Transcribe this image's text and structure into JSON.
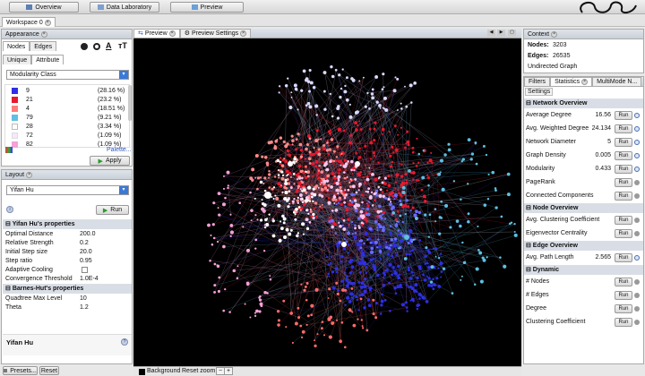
{
  "toolbar": {
    "overview": "Overview",
    "data_lab": "Data Laboratory",
    "preview": "Preview"
  },
  "workspace": {
    "tab": "Workspace 0"
  },
  "appearance": {
    "title": "Appearance",
    "tabs": [
      "Nodes",
      "Edges"
    ],
    "subtabs": [
      "Unique",
      "Attribute"
    ],
    "dropdown": "Modularity Class",
    "palette": "Palette...",
    "apply": "Apply",
    "items": [
      {
        "color": "#2e2ee6",
        "label": "9",
        "pct": "(28.16 %)"
      },
      {
        "color": "#e6192e",
        "label": "21",
        "pct": "(23.2 %)"
      },
      {
        "color": "#ff7d7d",
        "label": "4",
        "pct": "(18.51 %)"
      },
      {
        "color": "#5fbfe0",
        "label": "79",
        "pct": "(9.21 %)"
      },
      {
        "color": "#ffffff",
        "label": "28",
        "pct": "(3.34 %)"
      },
      {
        "color": "#f8e6ff",
        "label": "72",
        "pct": "(1.09 %)"
      },
      {
        "color": "#f5a0d8",
        "label": "82",
        "pct": "(1.09 %)"
      }
    ]
  },
  "layout": {
    "title": "Layout",
    "algorithm": "Yifan Hu",
    "run": "Run",
    "props_title": "Yifan Hu's properties",
    "props": [
      {
        "k": "Optimal Distance",
        "v": "200.0"
      },
      {
        "k": "Relative Strength",
        "v": "0.2"
      },
      {
        "k": "Initial Step size",
        "v": "20.0"
      },
      {
        "k": "Step ratio",
        "v": "0.95"
      },
      {
        "k": "Adaptive Cooling",
        "v": ""
      },
      {
        "k": "Convergence Threshold",
        "v": "1.0E-4"
      }
    ],
    "bh_title": "Barnes-Hut's properties",
    "bh": [
      {
        "k": "Quadtree Max Level",
        "v": "10"
      },
      {
        "k": "Theta",
        "v": "1.2"
      }
    ],
    "footer": "Yifan Hu",
    "presets": "Presets...",
    "reset": "Reset"
  },
  "graph": {
    "tabs": [
      "Preview",
      "Preview Settings"
    ],
    "background": "Background",
    "reset_zoom": "Reset zoom",
    "minus": "−",
    "plus": "+"
  },
  "context": {
    "title": "Context",
    "nodes_label": "Nodes:",
    "nodes": "3203",
    "edges_label": "Edges:",
    "edges": "26535",
    "type": "Undirected Graph"
  },
  "stats": {
    "tabs": [
      "Filters",
      "Statistics",
      "MultiMode N..."
    ],
    "settings": "Settings",
    "run": "Run",
    "sections": [
      {
        "title": "Network Overview",
        "rows": [
          {
            "k": "Average Degree",
            "v": "16.56"
          },
          {
            "k": "Avg. Weighted Degree",
            "v": "24.134"
          },
          {
            "k": "Network Diameter",
            "v": "5"
          },
          {
            "k": "Graph Density",
            "v": "0.005"
          },
          {
            "k": "Modularity",
            "v": "0.433"
          },
          {
            "k": "PageRank",
            "v": ""
          },
          {
            "k": "Connected Components",
            "v": ""
          }
        ]
      },
      {
        "title": "Node Overview",
        "rows": [
          {
            "k": "Avg. Clustering Coefficient",
            "v": ""
          },
          {
            "k": "Eigenvector Centrality",
            "v": ""
          }
        ]
      },
      {
        "title": "Edge Overview",
        "rows": [
          {
            "k": "Avg. Path Length",
            "v": "2.565"
          }
        ]
      },
      {
        "title": "Dynamic",
        "rows": [
          {
            "k": "# Nodes",
            "v": ""
          },
          {
            "k": "# Edges",
            "v": ""
          },
          {
            "k": "Degree",
            "v": ""
          },
          {
            "k": "Clustering Coefficient",
            "v": ""
          }
        ]
      }
    ]
  }
}
